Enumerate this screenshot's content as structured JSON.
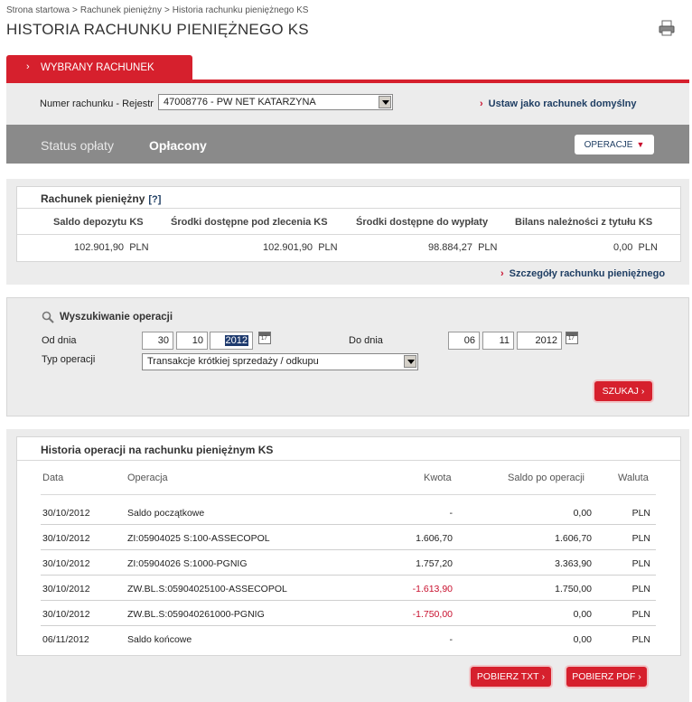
{
  "breadcrumb": [
    "Strona startowa",
    "Rachunek pieniężny",
    "Historia rachunku pieniężnego KS"
  ],
  "page_title": "HISTORIA RACHUNKU PIENIĘŻNEGO KS",
  "tab_label": "WYBRANY RACHUNEK",
  "account": {
    "label": "Numer rachunku - Rejestr",
    "selected": "47008776 - PW NET KATARZYNA",
    "set_default": "Ustaw jako rachunek domyślny"
  },
  "status": {
    "label": "Status opłaty",
    "value": "Opłacony",
    "operations_button": "OPERACJE"
  },
  "cash_account": {
    "title": "Rachunek pieniężny",
    "help": "[?]",
    "headers": [
      "Saldo depozytu KS",
      "Środki dostępne pod zlecenia KS",
      "Środki dostępne do wypłaty",
      "Bilans należności z tytułu KS"
    ],
    "values": [
      "102.901,90",
      "102.901,90",
      "98.884,27",
      "0,00"
    ],
    "currency": "PLN",
    "details_link": "Szczegóły rachunku pieniężnego"
  },
  "search": {
    "title": "Wyszukiwanie operacji",
    "from_label": "Od dnia",
    "from": {
      "day": "30",
      "month": "10",
      "year": "2012"
    },
    "to_label": "Do dnia",
    "to": {
      "day": "06",
      "month": "11",
      "year": "2012"
    },
    "type_label": "Typ operacji",
    "type_value": "Transakcje krótkiej sprzedaży / odkupu",
    "search_button": "SZUKAJ"
  },
  "history": {
    "title": "Historia operacji na rachunku pieniężnym KS",
    "headers": {
      "date": "Data",
      "operation": "Operacja",
      "amount": "Kwota",
      "balance": "Saldo po operacji",
      "currency": "Waluta"
    },
    "rows": [
      {
        "date": "30/10/2012",
        "operation": "Saldo początkowe",
        "amount": "-",
        "balance": "0,00",
        "currency": "PLN"
      },
      {
        "date": "30/10/2012",
        "operation": "ZI:05904025 S:100-ASSECOPOL",
        "amount": "1.606,70",
        "balance": "1.606,70",
        "currency": "PLN"
      },
      {
        "date": "30/10/2012",
        "operation": "ZI:05904026 S:1000-PGNIG",
        "amount": "1.757,20",
        "balance": "3.363,90",
        "currency": "PLN"
      },
      {
        "date": "30/10/2012",
        "operation": "ZW.BL.S:05904025100-ASSECOPOL",
        "amount": "-1.613,90",
        "balance": "1.750,00",
        "currency": "PLN"
      },
      {
        "date": "30/10/2012",
        "operation": "ZW.BL.S:059040261000-PGNIG",
        "amount": "-1.750,00",
        "balance": "0,00",
        "currency": "PLN"
      },
      {
        "date": "06/11/2012",
        "operation": "Saldo końcowe",
        "amount": "-",
        "balance": "0,00",
        "currency": "PLN"
      }
    ],
    "download_txt": "POBIERZ TXT",
    "download_pdf": "POBIERZ PDF"
  }
}
